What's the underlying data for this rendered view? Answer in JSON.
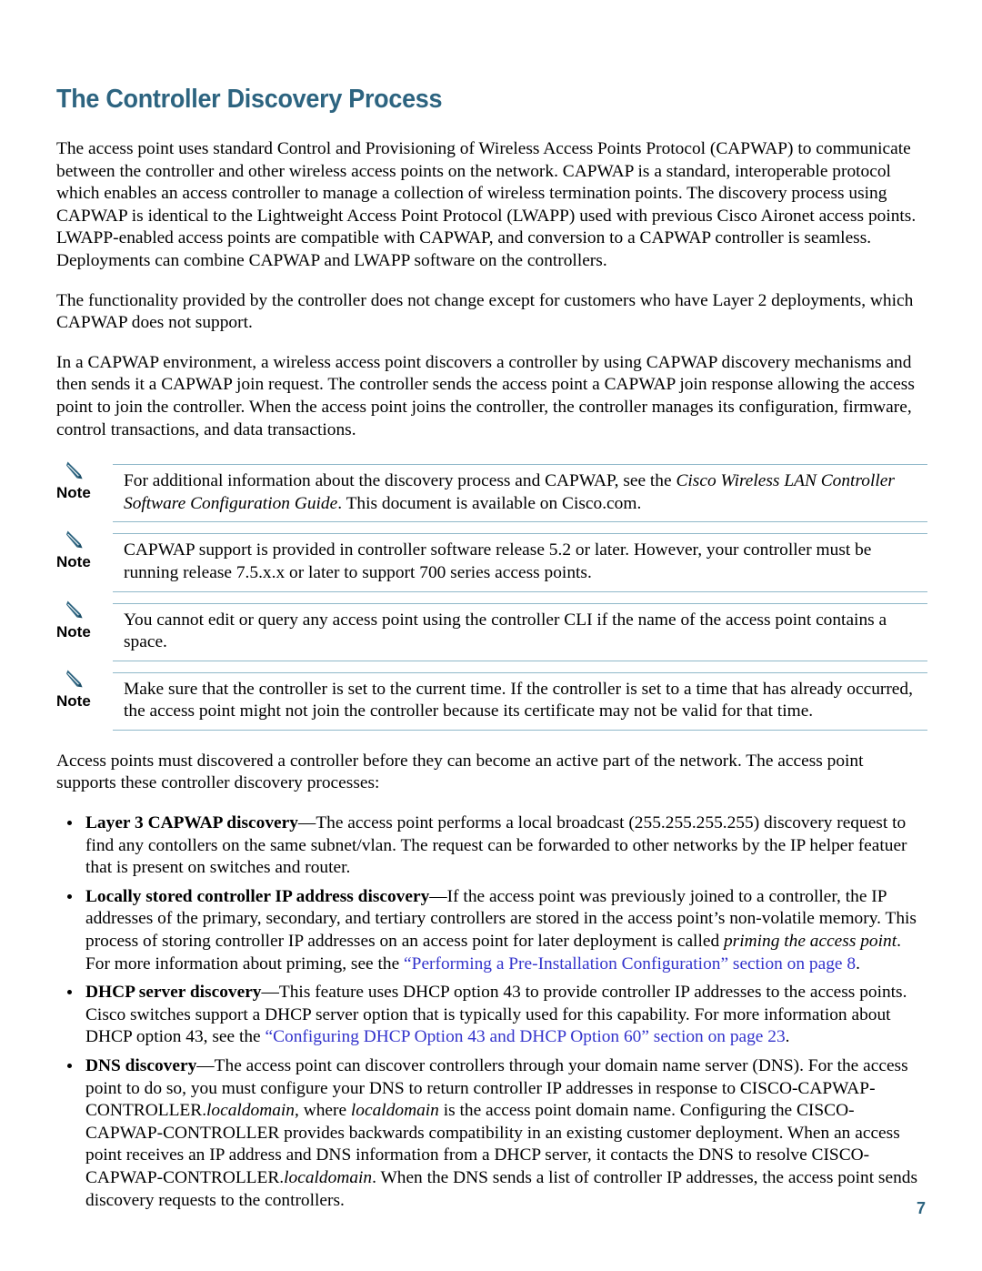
{
  "document": {
    "heading": "The Controller Discovery Process",
    "folio": "7",
    "accent_color": "#2d6480",
    "link_color": "#3333cc",
    "note_rule_color": "#8fb8c9"
  },
  "intro_paragraphs": [
    {
      "id": "para-capwap-overview",
      "runs": [
        {
          "t": "The access point uses standard Control and Provisioning of Wireless Access Points Protocol (CAPWAP) to communicate between the controller and other wireless access points on the network. CAPWAP is a standard, interoperable protocol which enables an access controller to manage a collection of wireless termination points. The discovery process using CAPWAP is identical to the Lightweight Access Point Protocol (LWAPP) used with previous Cisco Aironet access points. LWAPP-enabled access points are compatible with CAPWAP, and conversion to a CAPWAP controller is seamless. Deployments can combine CAPWAP and LWAPP software on the controllers.",
          "s": "plain"
        }
      ]
    },
    {
      "id": "para-layer2",
      "runs": [
        {
          "t": "The functionality provided by the controller does not change except for customers who have Layer 2 deployments, which CAPWAP does not support.",
          "s": "plain"
        }
      ]
    },
    {
      "id": "para-join-request",
      "runs": [
        {
          "t": "In a CAPWAP environment, a wireless access point discovers a controller by using CAPWAP discovery mechanisms and then sends it a CAPWAP join request. The controller sends the access point a CAPWAP join response allowing the access point to join the controller. When the access point joins the controller, the controller manages its configuration, firmware, control transactions, and data transactions.",
          "s": "plain"
        }
      ]
    }
  ],
  "notes": [
    {
      "id": "note-config-guide",
      "icon": "note-pencil-icon",
      "label": "Note",
      "runs": [
        {
          "t": "For additional information about the discovery process and CAPWAP, see the ",
          "s": "plain"
        },
        {
          "t": "Cisco Wireless LAN Controller Software Configuration Guide",
          "s": "italic"
        },
        {
          "t": ". This document is available on Cisco.com.",
          "s": "plain"
        }
      ]
    },
    {
      "id": "note-capwap-release",
      "icon": "note-pencil-icon",
      "label": "Note",
      "runs": [
        {
          "t": "CAPWAP support is provided in controller software release 5.2 or later. However, your controller must be running release 7.5.x.x or later to support 700 series access points.",
          "s": "plain"
        }
      ]
    },
    {
      "id": "note-cli-space",
      "icon": "note-pencil-icon",
      "label": "Note",
      "runs": [
        {
          "t": "You cannot edit or query any access point using the controller CLI if the name of the access point contains a space.",
          "s": "plain"
        }
      ]
    },
    {
      "id": "note-controller-time",
      "icon": "note-pencil-icon",
      "label": "Note",
      "runs": [
        {
          "t": "Make sure that the controller is set to the current time. If the controller is set to a time that has already occurred, the access point might not join the controller because its certificate may not be valid for that time.",
          "s": "plain"
        }
      ]
    }
  ],
  "list_lead_paragraph": {
    "id": "para-discovery-processes",
    "runs": [
      {
        "t": "Access points must discovered a controller before they can become an active part of the network. The access point supports these controller discovery processes:",
        "s": "plain"
      }
    ]
  },
  "discovery_list": [
    {
      "id": "bullet-layer3-capwap",
      "runs": [
        {
          "t": "Layer 3 CAPWAP discovery",
          "s": "bold"
        },
        {
          "t": "—The access point performs a local broadcast (255.255.255.255) discovery request to find any contollers on the same subnet/vlan. The request can be forwarded to other networks by the IP helper featuer that is present on switches and router.",
          "s": "plain"
        }
      ]
    },
    {
      "id": "bullet-locally-stored-ip",
      "runs": [
        {
          "t": "Locally stored controller IP address discovery",
          "s": "bold"
        },
        {
          "t": "—If the access point was previously joined to a controller, the IP addresses of the primary, secondary, and tertiary controllers are stored in the access point’s non-volatile memory. This process of storing controller IP addresses on an access point for later deployment is called ",
          "s": "plain"
        },
        {
          "t": "priming the access point",
          "s": "italic"
        },
        {
          "t": ". For more information about priming, see the ",
          "s": "plain"
        },
        {
          "t": "“Performing a Pre-Installation Configuration” section on page 8",
          "s": "link"
        },
        {
          "t": ".",
          "s": "plain"
        }
      ]
    },
    {
      "id": "bullet-dhcp-server",
      "runs": [
        {
          "t": "DHCP server discovery",
          "s": "bold"
        },
        {
          "t": "—This feature uses DHCP option 43 to provide controller IP addresses to the access points. Cisco switches support a DHCP server option that is typically used for this capability. For more information about DHCP option 43, see the ",
          "s": "plain"
        },
        {
          "t": "“Configuring DHCP Option 43 and DHCP Option 60” section on page 23",
          "s": "link"
        },
        {
          "t": ".",
          "s": "plain"
        }
      ]
    },
    {
      "id": "bullet-dns-discovery",
      "runs": [
        {
          "t": "DNS discovery",
          "s": "bold"
        },
        {
          "t": "—The access point can discover controllers through your domain name server (DNS). For the access point to do so, you must configure your DNS to return controller IP addresses in response to CISCO-CAPWAP-CONTROLLER.",
          "s": "plain"
        },
        {
          "t": "localdomain",
          "s": "italic"
        },
        {
          "t": ", where ",
          "s": "plain"
        },
        {
          "t": "localdomain",
          "s": "italic"
        },
        {
          "t": " is the access point domain name. Configuring the CISCO-CAPWAP-CONTROLLER provides backwards compatibility in an existing customer deployment. When an access point receives an IP address and DNS information from a DHCP server, it contacts the DNS to resolve CISCO-CAPWAP-CONTROLLER.",
          "s": "plain"
        },
        {
          "t": "localdomain",
          "s": "italic"
        },
        {
          "t": ". When the DNS sends a list of controller IP addresses, the access point sends discovery requests to the controllers.",
          "s": "plain"
        }
      ]
    }
  ]
}
